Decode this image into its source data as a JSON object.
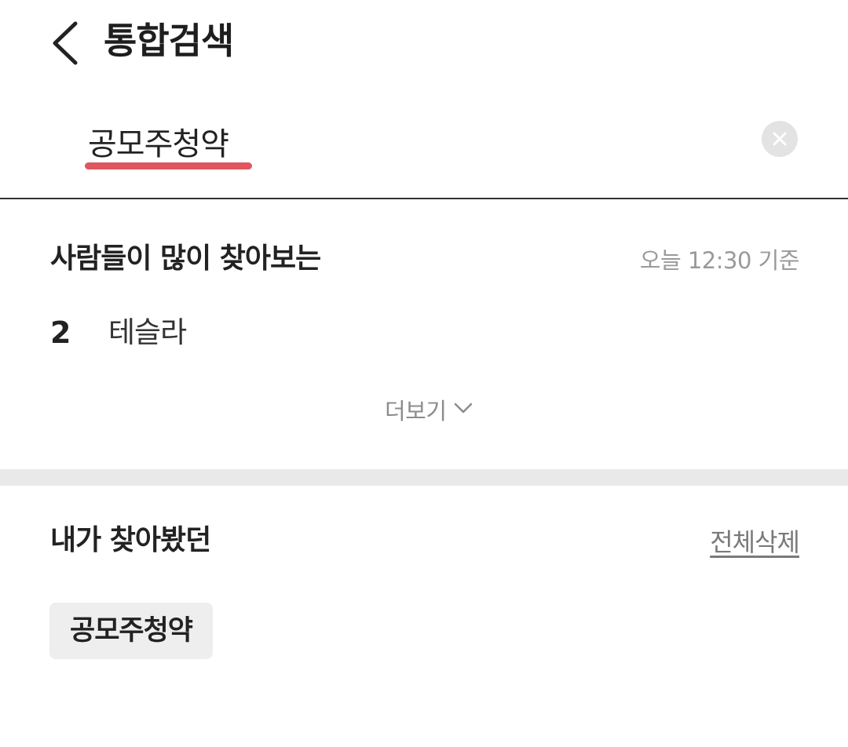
{
  "header": {
    "back_icon": "chevron-left-icon",
    "title": "통합검색"
  },
  "search": {
    "value": "공모주청약",
    "clear_icon": "close-circle-icon",
    "underline_color": "#e0565f"
  },
  "popular": {
    "title": "사람들이 많이 찾아보는",
    "timestamp": "오늘 12:30 기준",
    "items": [
      {
        "rank": "2",
        "keyword": "테슬라"
      }
    ],
    "more_label": "더보기",
    "more_icon": "chevron-down-icon"
  },
  "recent": {
    "title": "내가 찾아봤던",
    "delete_all_label": "전체삭제",
    "items": [
      {
        "label": "공모주청약"
      }
    ]
  }
}
